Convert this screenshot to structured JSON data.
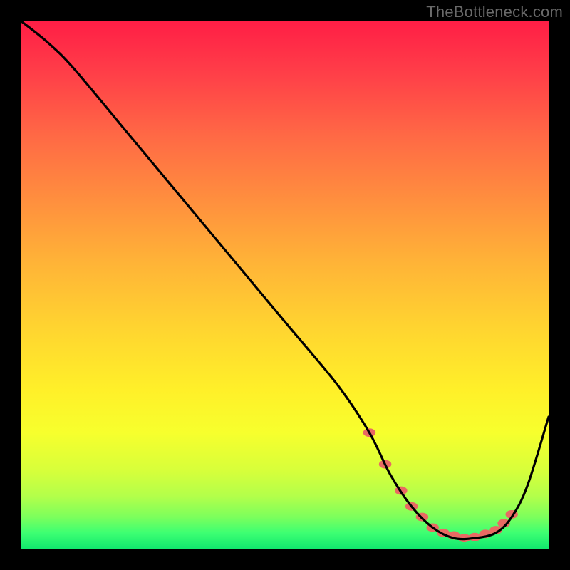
{
  "watermark": "TheBottleneck.com",
  "chart_data": {
    "type": "line",
    "title": "",
    "xlabel": "",
    "ylabel": "",
    "xlim": [
      0,
      100
    ],
    "ylim": [
      0,
      100
    ],
    "grid": false,
    "background_gradient": [
      "#ff1e46",
      "#ffd430",
      "#12e86e"
    ],
    "series": [
      {
        "name": "bottleneck-curve",
        "color": "#000000",
        "x": [
          0,
          5,
          10,
          20,
          30,
          40,
          50,
          60,
          66,
          70,
          74,
          78,
          82,
          86,
          90,
          93,
          96,
          100
        ],
        "y": [
          100,
          96,
          91,
          79,
          67,
          55,
          43,
          31,
          22,
          14,
          8,
          4,
          2,
          2,
          3,
          6,
          12,
          25
        ]
      }
    ],
    "markers": {
      "name": "optimal-range-dots",
      "color": "#e86a63",
      "radius": 7,
      "x": [
        66,
        69,
        72,
        74,
        76,
        78,
        80,
        82,
        84,
        86,
        88,
        90,
        91.5,
        93
      ],
      "y": [
        22,
        16,
        11,
        8,
        6,
        4,
        3,
        2.5,
        2,
        2.2,
        2.8,
        3.5,
        4.8,
        6.5
      ]
    }
  }
}
